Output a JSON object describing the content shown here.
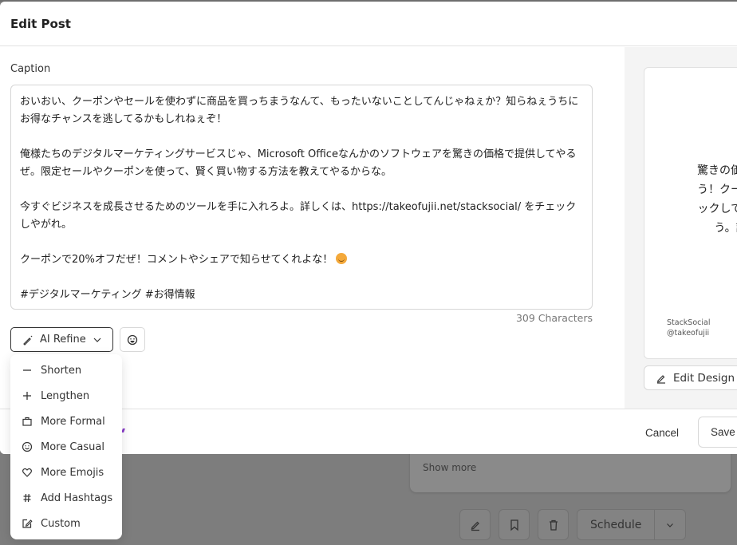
{
  "background": {
    "show_more_label": "Show more",
    "schedule_label": "Schedule",
    "actions": [
      "edit-icon",
      "bookmark-icon",
      "trash-icon"
    ]
  },
  "modal": {
    "title": "Edit Post",
    "caption": {
      "label": "Caption",
      "paragraphs": [
        "おいおい、クーポンやセールを使わずに商品を買っちまうなんて、もったいないことしてんじゃねぇか？知らねぇうちにお得なチャンスを逃してるかもしれねぇぞ！",
        "俺様たちのデジタルマーケティングサービスじゃ、Microsoft Officeなんかのソフトウェアを驚きの価格で提供してやるぜ。限定セールやクーポンを使って、賢く買い物する方法を教えてやるからな。",
        "今すぐビジネスを成長させるためのツールを手に入れろよ。詳しくは、https://takeofujii.net/stacksocial/ をチェックしやがれ。",
        "クーポンで20%オフだぜ！コメントやシェアで知らせてくれよな！",
        "#デジタルマーケティング #お得情報"
      ],
      "emoji": "smiling-face-emoji",
      "char_count": "309 Characters"
    },
    "ai_refine": {
      "label": "AI Refine",
      "menu": [
        {
          "icon": "minus-icon",
          "label": "Shorten"
        },
        {
          "icon": "plus-icon",
          "label": "Lengthen"
        },
        {
          "icon": "briefcase-icon",
          "label": "More Formal"
        },
        {
          "icon": "smile-icon",
          "label": "More Casual"
        },
        {
          "icon": "heart-icon",
          "label": "More Emojis"
        },
        {
          "icon": "hash-icon",
          "label": "Add Hashtags"
        },
        {
          "icon": "edit-square-icon",
          "label": "Custom"
        }
      ]
    },
    "preview": {
      "text": "驚きの価格で\nう！クーポン\nックして、賢\nう。詳",
      "brand_name": "StackSocial",
      "brand_handle": "@takeofujii",
      "edit_design_label": "Edit Design"
    },
    "footer": {
      "cancel_label": "Cancel",
      "save_label": "Save"
    }
  }
}
